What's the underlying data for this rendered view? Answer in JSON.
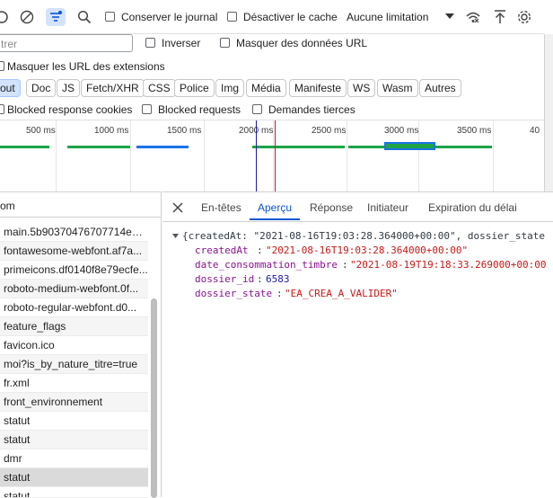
{
  "toolbar": {
    "preserve_log_label": "Conserver le journal",
    "disable_cache_label": "Désactiver le cache",
    "throttling_value": "Aucune limitation"
  },
  "filter": {
    "placeholder_partial": "trer",
    "invert_label": "Inverser",
    "hide_data_urls_label": "Masquer des données URL",
    "hide_extension_urls_label": "Masquer les URL des extensions"
  },
  "types": {
    "all_partial": "out",
    "items": [
      "Doc",
      "JS",
      "Fetch/XHR",
      "CSS",
      "Police",
      "Img",
      "Média",
      "Manifeste",
      "WS",
      "Wasm",
      "Autres"
    ]
  },
  "blocked": {
    "cookies_label": "Blocked response cookies",
    "requests_label": "Blocked requests",
    "third_party_label": "Demandes tierces"
  },
  "timeline": {
    "ticks": [
      "500 ms",
      "1000 ms",
      "1500 ms",
      "2000 ms",
      "2500 ms",
      "3000 ms",
      "3500 ms",
      "40"
    ]
  },
  "requests": {
    "header": "om",
    "items": [
      "main.5b90370476707714eef...",
      "fontawesome-webfont.af7a...",
      "primeicons.df0140f8e79ecfe...",
      "roboto-medium-webfont.0f...",
      "roboto-regular-webfont.d0...",
      "feature_flags",
      "favicon.ico",
      "moi?is_by_nature_titre=true",
      "fr.xml",
      "front_environnement",
      "statut",
      "statut",
      "dmr",
      "statut",
      "statut"
    ],
    "selected_index": 13
  },
  "detail": {
    "tabs": [
      "En-têtes",
      "Aperçu",
      "Réponse",
      "Initiateur",
      "Expiration du délai"
    ],
    "active_tab": "Aperçu",
    "summary": "{createdAt: \"2021-08-16T19:03:28.364000+00:00\", dossier_state",
    "fields": [
      {
        "key": "createdAt",
        "value": "\"2021-08-16T19:03:28.364000+00:00\"",
        "kind": "string"
      },
      {
        "key": "date_consommation_timbre",
        "value": "\"2021-08-19T19:18:33.269000+00:00",
        "kind": "string"
      },
      {
        "key": "dossier_id",
        "value": "6583",
        "kind": "number"
      },
      {
        "key": "dossier_state",
        "value": "\"EA_CREA_A_VALIDER\"",
        "kind": "string"
      }
    ]
  },
  "colors": {
    "accent": "#0b57d0",
    "chip_active": "#d3e3fd",
    "timeline_green": "#1ea446",
    "timeline_blue": "#1a73e8"
  }
}
